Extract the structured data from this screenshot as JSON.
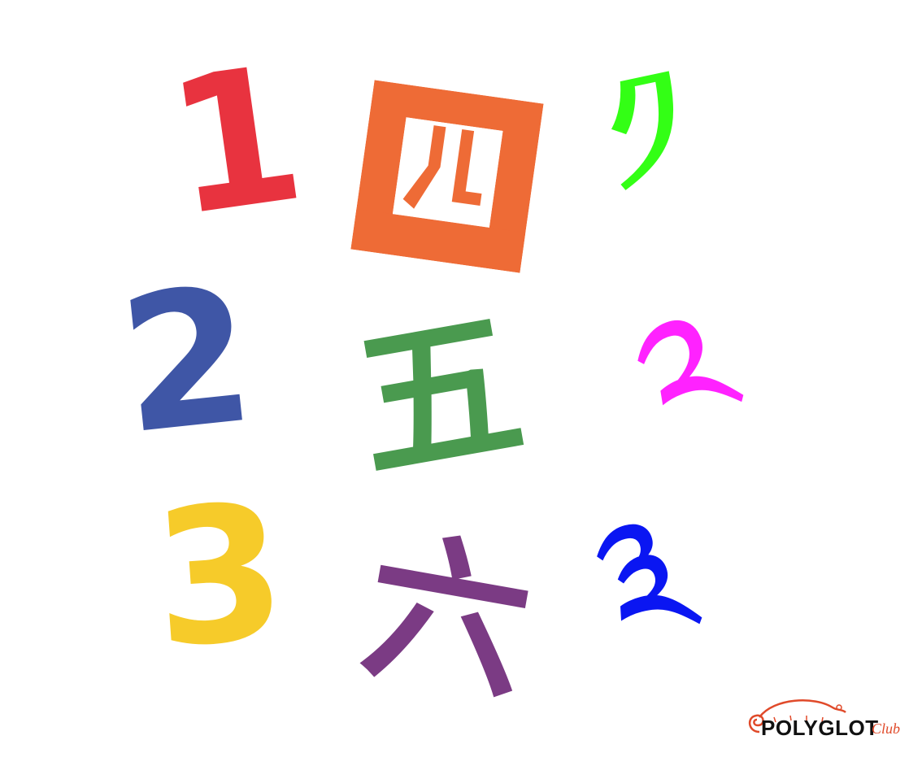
{
  "numerals": {
    "western": [
      "1",
      "2",
      "3"
    ],
    "chinese": [
      "四",
      "五",
      "六"
    ],
    "tibetan": [
      "༡",
      "༢",
      "༣"
    ]
  },
  "colors": {
    "one": "#e8333f",
    "two": "#3f56a6",
    "three": "#f6cb2a",
    "four": "#ee6b36",
    "five": "#4a9a4f",
    "six": "#7b3b84",
    "tibetan_one": "#33ff15",
    "tibetan_two": "#ff22ff",
    "tibetan_three": "#0a16f2",
    "logo_text": "#111111",
    "logo_accent": "#e04a2a"
  },
  "logo": {
    "name": "POLYGLOT",
    "suffix": "Club"
  }
}
